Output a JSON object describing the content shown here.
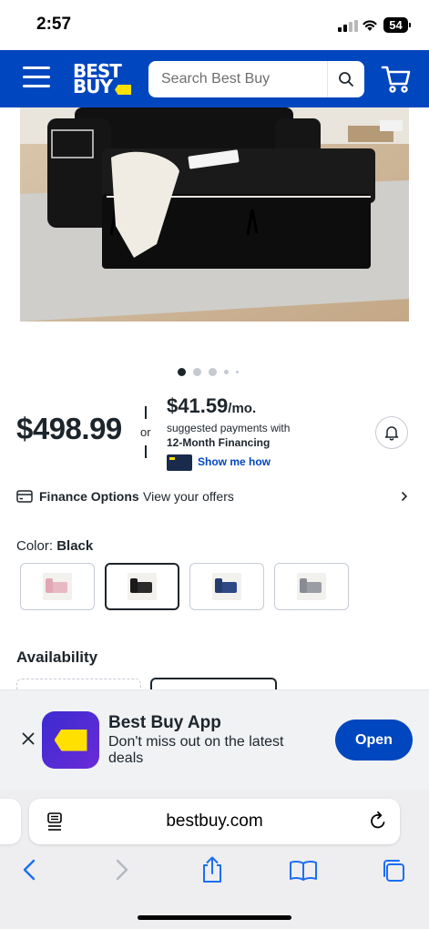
{
  "status_bar": {
    "time": "2:57",
    "battery": "54"
  },
  "header": {
    "logo_line1": "BEST",
    "logo_line2": "BUY",
    "search_placeholder": "Search Best Buy"
  },
  "product": {
    "price": "$498.99",
    "or_label": "or",
    "monthly_price": "$41.59",
    "monthly_suffix": "/mo.",
    "suggested_text": "suggested payments with",
    "financing_term": "12-Month Financing",
    "show_me_how": "Show me how",
    "image_count": 5,
    "active_image": 1
  },
  "finance": {
    "title": "Finance Options",
    "subtitle": "View your offers"
  },
  "color": {
    "label": "Color:",
    "selected": "Black",
    "swatches": [
      {
        "name": "pink",
        "hex": "#e8b9c3"
      },
      {
        "name": "black",
        "hex": "#2a2a2a"
      },
      {
        "name": "blue",
        "hex": "#2d4a86"
      },
      {
        "name": "gray",
        "hex": "#9a9ea4"
      }
    ]
  },
  "availability": {
    "title": "Availability"
  },
  "app_banner": {
    "title": "Best Buy App",
    "subtitle": "Don't miss out on the latest deals",
    "button": "Open"
  },
  "browser": {
    "url": "bestbuy.com"
  },
  "colors": {
    "brand_blue": "#0046be",
    "brand_yellow": "#ffe000",
    "text_dark": "#1d252c"
  }
}
